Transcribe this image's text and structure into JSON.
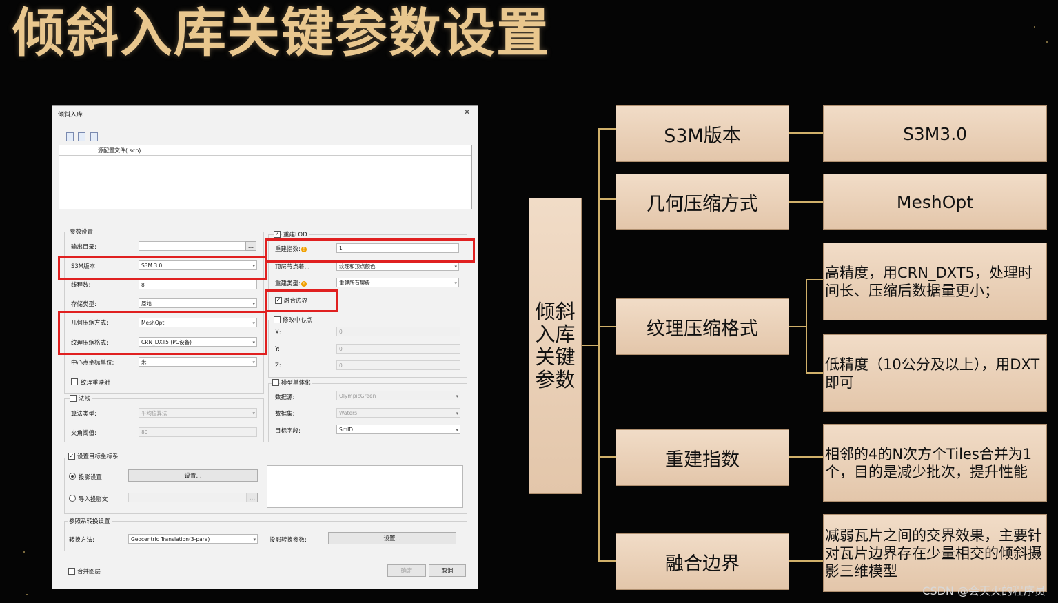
{
  "slide": {
    "title": "倾斜入库关键参数设置",
    "watermark": "CSDN @会灭火的程序员"
  },
  "dialog": {
    "title": "倾斜入库",
    "close_icon": "close-icon",
    "toolbar_icons": [
      "add-file-icon",
      "open-folder-icon",
      "delete-icon"
    ],
    "file_table_header": "源配置文件(.scp)",
    "param_group": "参数设置",
    "output_dir": {
      "label": "输出目录:",
      "value": ""
    },
    "s3m_version": {
      "label": "S3M版本:",
      "value": "S3M 3.0"
    },
    "threads": {
      "label": "线程数:",
      "value": "8"
    },
    "storage_type": {
      "label": "存储类型:",
      "value": "原始"
    },
    "geom_compress": {
      "label": "几何压缩方式:",
      "value": "MeshOpt"
    },
    "tex_compress": {
      "label": "纹理压缩格式:",
      "value": "CRN_DXT5 (PC设备)"
    },
    "center_unit": {
      "label": "中心点坐标单位:",
      "value": "米"
    },
    "tex_remap": {
      "label": "纹理重映射",
      "checked": false
    },
    "normal_group": {
      "label": "法线",
      "checked": false
    },
    "algo_type": {
      "label": "算法类型:",
      "value": "平均值算法"
    },
    "angle_threshold": {
      "label": "夹角阈值:",
      "value": "80"
    },
    "rebuild_lod": {
      "label": "重建LOD",
      "checked": true
    },
    "rebuild_index": {
      "label": "重建指数:",
      "value": "1"
    },
    "top_node": {
      "label": "顶层节点着...",
      "value": "纹理和顶点颜色"
    },
    "rebuild_type": {
      "label": "重建类型:",
      "value": "重建所有层级"
    },
    "merge_border": {
      "label": "融合边界",
      "checked": true
    },
    "modify_center": {
      "label": "修改中心点",
      "checked": false
    },
    "center_x": {
      "label": "X:",
      "value": "0"
    },
    "center_y": {
      "label": "Y:",
      "value": "0"
    },
    "center_z": {
      "label": "Z:",
      "value": "0"
    },
    "model_single": {
      "label": "模型单体化",
      "checked": false
    },
    "datasource": {
      "label": "数据源:",
      "value": "OlympicGreen"
    },
    "dataset": {
      "label": "数据集:",
      "value": "Waters"
    },
    "target_field": {
      "label": "目标字段:",
      "value": "SmID"
    },
    "set_target_coord": {
      "label": "设置目标坐标系",
      "checked": true
    },
    "proj_settings": {
      "label": "投影设置",
      "selected": true,
      "button": "设置..."
    },
    "import_proj": {
      "label": "导入投影文",
      "selected": false
    },
    "ref_group": "参照系转换设置",
    "convert_method": {
      "label": "转换方法:",
      "value": "Geocentric Translation(3-para)"
    },
    "proj_convert_params": {
      "label": "投影转换参数:",
      "button": "设置..."
    },
    "merge_layers": {
      "label": "合并图层",
      "checked": false
    },
    "ok_button": "确定",
    "cancel_button": "取消"
  },
  "mindmap": {
    "root": "倾斜入库关键参数",
    "nodes": [
      {
        "label": "S3M版本",
        "children": [
          "S3M3.0"
        ]
      },
      {
        "label": "几何压缩方式",
        "children": [
          "MeshOpt"
        ]
      },
      {
        "label": "纹理压缩格式",
        "children": [
          "高精度，用CRN_DXT5，处理时间长、压缩后数据量更小；",
          "低精度（10公分及以上），用DXT即可"
        ]
      },
      {
        "label": "重建指数",
        "children": [
          "相邻的4的N次方个Tiles合并为1个，目的是减少批次，提升性能"
        ]
      },
      {
        "label": "融合边界",
        "children": [
          "减弱瓦片之间的交界效果，主要针对瓦片边界存在少量相交的倾斜摄影三维模型"
        ]
      }
    ]
  },
  "colors": {
    "title_gold": "#e9c78e",
    "node_fill": "#e8cdb2",
    "connector": "#d0b06a",
    "highlight_red": "#e02020"
  }
}
